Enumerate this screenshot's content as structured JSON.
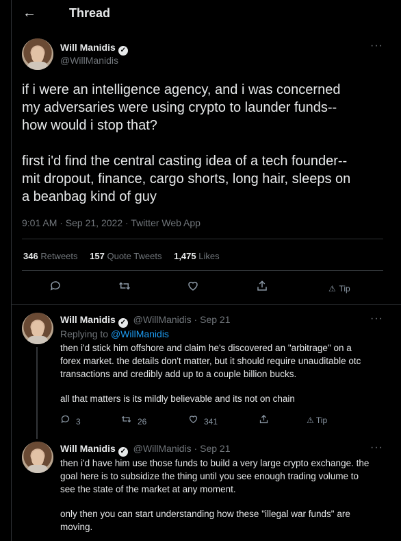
{
  "header": {
    "back_icon": "←",
    "title": "Thread"
  },
  "main_tweet": {
    "name": "Will Manidis",
    "handle": "@WillManidis",
    "more": "···",
    "paragraph1_lines": [
      "if i were an intelligence agency, and i was concerned",
      "my  adversaries were using crypto to launder funds--",
      "how would i stop that?"
    ],
    "paragraph2_lines": [
      "first i'd find the central casting idea of a tech founder--",
      "mit dropout, finance, cargo shorts, long hair, sleeps on",
      "a beanbag kind of guy"
    ],
    "meta": "9:01 AM · Sep 21, 2022 · Twitter Web App",
    "retweets_count": "346",
    "retweets_label": "Retweets",
    "quotes_count": "157",
    "quotes_label": "Quote Tweets",
    "likes_count": "1,475",
    "likes_label": "Likes",
    "tip_label": "Tip"
  },
  "reply1": {
    "name": "Will Manidis",
    "handle_time": "@WillManidis · Sep 21",
    "more": "···",
    "replying_prefix": "Replying to",
    "replying_handle": "@WillManidis",
    "lines": [
      "then i'd stick him offshore and claim he's discovered an \"arbitrage\" on a",
      "forex market. the details don't matter, but it should require unauditable otc",
      "transactions and credibly add up to a couple billion bucks."
    ],
    "line2": "all that matters is its mildly believable and its not on chain",
    "replies": "3",
    "retweets": "26",
    "likes": "341",
    "tip_label": "Tip"
  },
  "reply2": {
    "name": "Will Manidis",
    "handle_time": "@WillManidis · Sep 21",
    "more": "···",
    "lines": [
      "then i'd have him use those funds to build a very large crypto exchange. the",
      "goal here is to subsidize the thing until you see enough trading volume to",
      "see the state of the market at any moment."
    ],
    "lines2": [
      "only then you can start understanding how these \"illegal war funds\" are",
      "moving."
    ]
  }
}
